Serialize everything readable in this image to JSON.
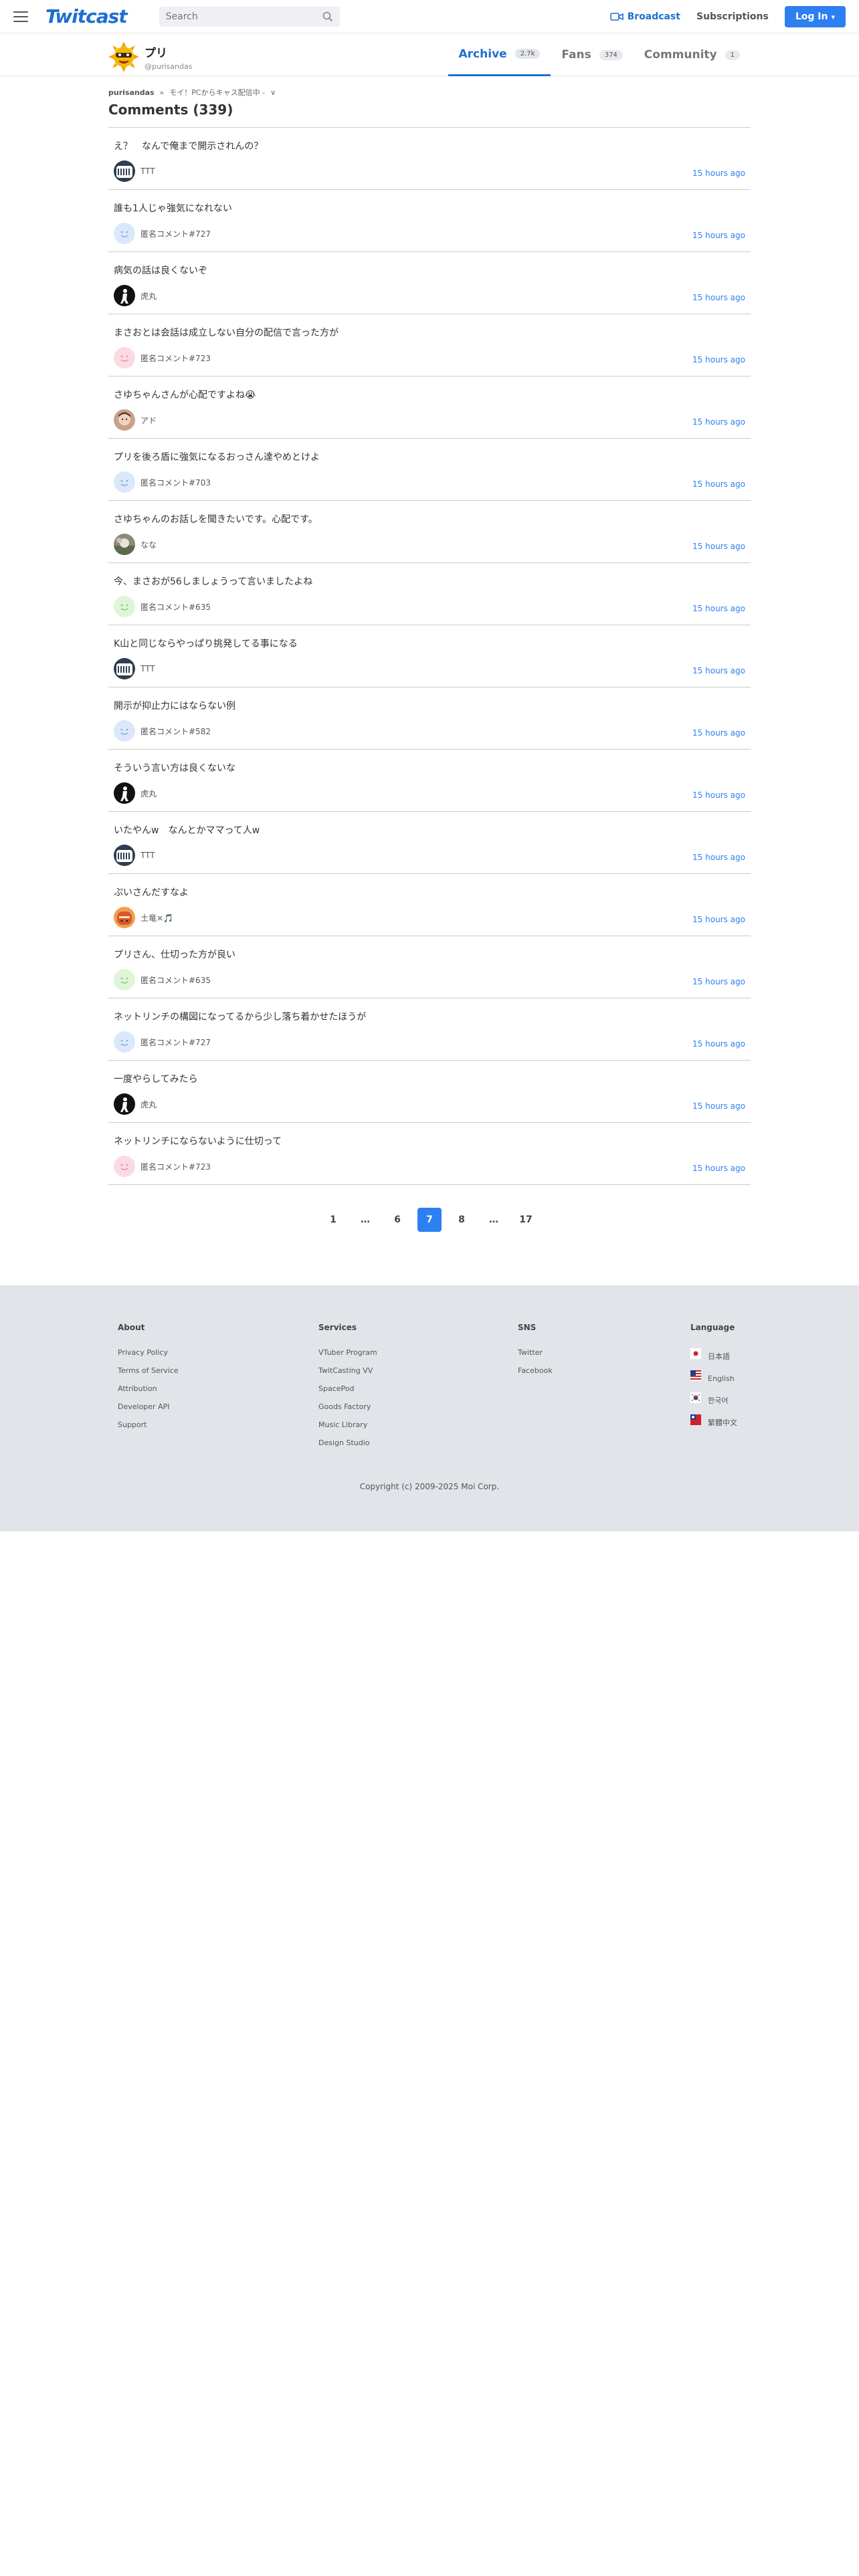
{
  "header": {
    "logo": "Twitcast",
    "search_placeholder": "Search",
    "broadcast_label": "Broadcast",
    "subscriptions_label": "Subscriptions",
    "login_label": "Log In",
    "accent_color": "#2d7ff2"
  },
  "profile": {
    "name": "プリ",
    "handle": "@purisandas"
  },
  "tabs": [
    {
      "label": "Archive",
      "count": "2.7k",
      "active": true
    },
    {
      "label": "Fans",
      "count": "374",
      "active": false
    },
    {
      "label": "Community",
      "count": "1",
      "active": false
    }
  ],
  "breadcrumb": {
    "user": "purisandas",
    "separator": "»",
    "item": "モイ！PCからキャス配信中 -",
    "chevron": "∨"
  },
  "page_title": "Comments (339)",
  "comments": [
    {
      "text": "え？　なんで俺まで開示されんの？",
      "user": "TTT",
      "time": "15 hours ago",
      "avatar": "ttt"
    },
    {
      "text": "誰も1人じゃ強気になれない",
      "user": "匿名コメント#727",
      "time": "15 hours ago",
      "avatar": "anon-blue"
    },
    {
      "text": "病気の話は良くないぞ",
      "user": "虎丸",
      "time": "15 hours ago",
      "avatar": "tora"
    },
    {
      "text": "まさおとは会話は成立しない自分の配信で言った方が",
      "user": "匿名コメント#723",
      "time": "15 hours ago",
      "avatar": "anon-pink"
    },
    {
      "text": "さゆちゃんさんが心配ですよね😭",
      "user": "アド",
      "time": "15 hours ago",
      "avatar": "ado"
    },
    {
      "text": "プリを後ろ盾に強気になるおっさん達やめとけよ",
      "user": "匿名コメント#703",
      "time": "15 hours ago",
      "avatar": "anon-blue"
    },
    {
      "text": "さゆちゃんのお話しを聞きたいです。心配です。",
      "user": "なな",
      "time": "15 hours ago",
      "avatar": "nana"
    },
    {
      "text": "今、まさおが56しましょうって言いましたよね",
      "user": "匿名コメント#635",
      "time": "15 hours ago",
      "avatar": "anon-green"
    },
    {
      "text": "K山と同じならやっぱり挑発してる事になる",
      "user": "TTT",
      "time": "15 hours ago",
      "avatar": "ttt"
    },
    {
      "text": "開示が抑止力にはならない例",
      "user": "匿名コメント#582",
      "time": "15 hours ago",
      "avatar": "anon-blue"
    },
    {
      "text": "そういう言い方は良くないな",
      "user": "虎丸",
      "time": "15 hours ago",
      "avatar": "tora"
    },
    {
      "text": "いたやんw　なんとかママって人w",
      "user": "TTT",
      "time": "15 hours ago",
      "avatar": "ttt"
    },
    {
      "text": "ぷいさんだすなよ",
      "user": "土竜×🎵",
      "time": "15 hours ago",
      "avatar": "mogura"
    },
    {
      "text": "プリさん、仕切った方が良い",
      "user": "匿名コメント#635",
      "time": "15 hours ago",
      "avatar": "anon-green"
    },
    {
      "text": "ネットリンチの構図になってるから少し落ち着かせたほうが",
      "user": "匿名コメント#727",
      "time": "15 hours ago",
      "avatar": "anon-blue"
    },
    {
      "text": "一度やらしてみたら",
      "user": "虎丸",
      "time": "15 hours ago",
      "avatar": "tora"
    },
    {
      "text": "ネットリンチにならないように仕切って",
      "user": "匿名コメント#723",
      "time": "15 hours ago",
      "avatar": "anon-pink"
    }
  ],
  "pagination": [
    "1",
    "…",
    "6",
    "7",
    "8",
    "…",
    "17"
  ],
  "pagination_current": "7",
  "footer": {
    "about": {
      "title": "About",
      "links": [
        "Privacy Policy",
        "Terms of Service",
        "Attribution",
        "Developer API",
        "Support"
      ]
    },
    "services": {
      "title": "Services",
      "links": [
        "VTuber Program",
        "TwitCasting VV",
        "SpacePod",
        "Goods Factory",
        "Music Library",
        "Design Studio"
      ]
    },
    "sns": {
      "title": "SNS",
      "links": [
        "Twitter",
        "Facebook"
      ]
    },
    "language": {
      "title": "Language",
      "links": [
        "日本語",
        "English",
        "한국어",
        "繁體中文"
      ]
    },
    "copyright": "Copyright (c) 2009-2025 Moi Corp."
  }
}
